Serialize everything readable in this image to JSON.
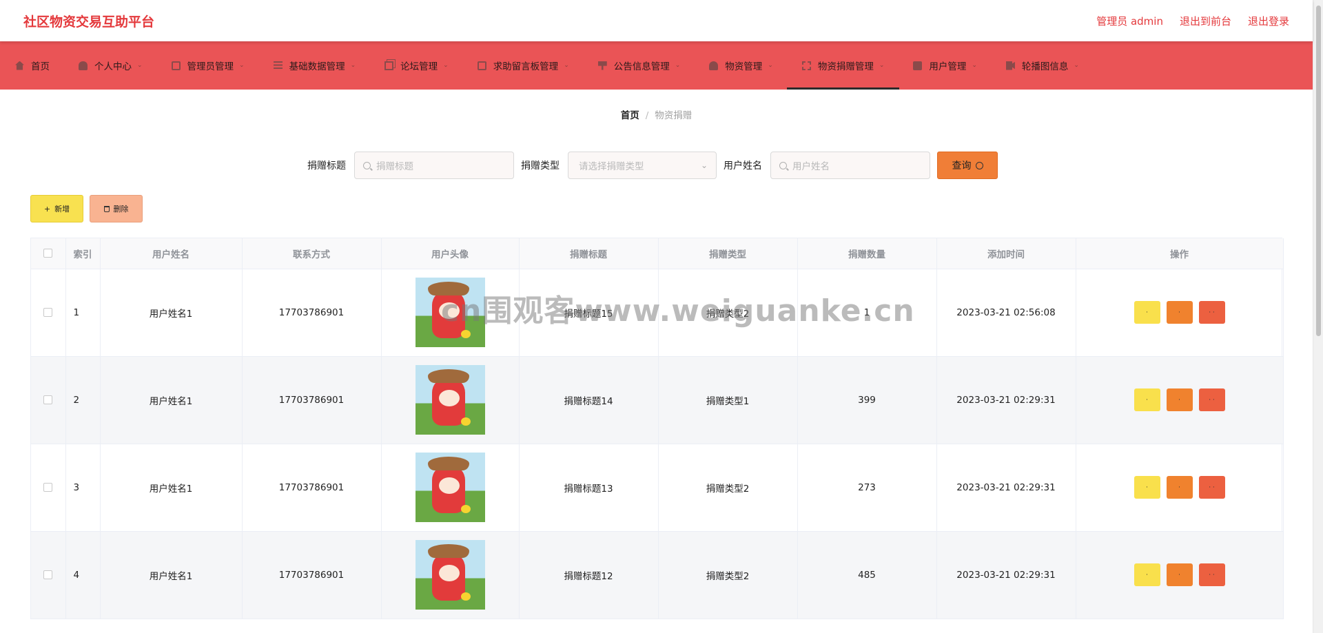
{
  "app": {
    "title": "社区物资交易互助平台",
    "admin_label": "管理员 admin",
    "back_to_front": "退出到前台",
    "logout": "退出登录"
  },
  "colors": {
    "accent": "#ea5456",
    "brand_text": "#e4393c",
    "query_button": "#f07e37",
    "add_button": "#f8e150",
    "delete_button": "#f9b391"
  },
  "nav": {
    "items": [
      {
        "label": "首页",
        "icon": "home-icon"
      },
      {
        "label": "个人中心",
        "icon": "user-icon"
      },
      {
        "label": "管理员管理",
        "icon": "clipboard-icon"
      },
      {
        "label": "基础数据管理",
        "icon": "list-icon"
      },
      {
        "label": "论坛管理",
        "icon": "copy-icon"
      },
      {
        "label": "求助留言板管理",
        "icon": "message-icon"
      },
      {
        "label": "公告信息管理",
        "icon": "signpost-icon"
      },
      {
        "label": "物资管理",
        "icon": "person-icon"
      },
      {
        "label": "物资捐赠管理",
        "icon": "expand-icon"
      },
      {
        "label": "用户管理",
        "icon": "screen-icon"
      },
      {
        "label": "轮播图信息",
        "icon": "video-icon"
      }
    ],
    "active": "物资捐赠管理"
  },
  "breadcrumb": {
    "home": "首页",
    "separator": "/",
    "current": "物资捐赠"
  },
  "search": {
    "title_label": "捐赠标题",
    "title_placeholder": "捐赠标题",
    "type_label": "捐赠类型",
    "type_placeholder": "请选择捐赠类型",
    "user_label": "用户姓名",
    "user_placeholder": "用户姓名",
    "query_label": "查询"
  },
  "actions": {
    "add_label": "新增",
    "delete_label": "删除"
  },
  "table": {
    "headers": [
      "索引",
      "用户姓名",
      "联系方式",
      "用户头像",
      "捐赠标题",
      "捐赠类型",
      "捐赠数量",
      "添加时间",
      "操作"
    ],
    "rows": [
      {
        "index": "1",
        "user": "用户姓名1",
        "phone": "17703786901",
        "title": "捐赠标题15",
        "type": "捐赠类型2",
        "qty": "1",
        "time": "2023-03-21 02:56:08"
      },
      {
        "index": "2",
        "user": "用户姓名1",
        "phone": "17703786901",
        "title": "捐赠标题14",
        "type": "捐赠类型1",
        "qty": "399",
        "time": "2023-03-21 02:29:31"
      },
      {
        "index": "3",
        "user": "用户姓名1",
        "phone": "17703786901",
        "title": "捐赠标题13",
        "type": "捐赠类型2",
        "qty": "273",
        "time": "2023-03-21 02:29:31"
      },
      {
        "index": "4",
        "user": "用户姓名1",
        "phone": "17703786901",
        "title": "捐赠标题12",
        "type": "捐赠类型2",
        "qty": "485",
        "time": "2023-03-21 02:29:31"
      }
    ],
    "op_labels": {
      "view": "·",
      "edit": "·",
      "delete": "· ·"
    }
  },
  "watermark": "cn围观客www.weiguanke.cn"
}
